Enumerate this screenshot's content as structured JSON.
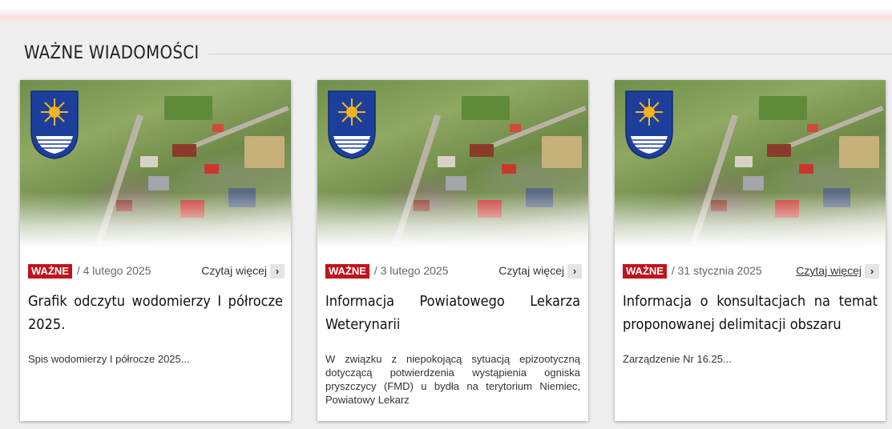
{
  "section": {
    "title": "WAŻNE WIADOMOŚCI"
  },
  "colors": {
    "badge": "#c0141b",
    "crest_blue": "#1d3f9c",
    "crest_gold": "#f2b321"
  },
  "cards": [
    {
      "badge": "WAŻNE",
      "date": "/ 4 lutego 2025",
      "read_more": "Czytaj więcej",
      "chevron": "›",
      "title": "Grafik odczytu wodomierzy I półrocze 2025.",
      "excerpt": "Spis wodomierzy I półrocze 2025..."
    },
    {
      "badge": "WAŻNE",
      "date": "/ 3 lutego 2025",
      "read_more": "Czytaj więcej",
      "chevron": "›",
      "title": "Informacja Powiatowego Lekarza Weterynarii",
      "excerpt": "W związku z niepokojącą sytuacją epizootyczną dotyczącą potwierdzenia wystąpienia ogniska pryszczycy (FMD) u bydła na terytorium Niemiec, Powiatowy Lekarz"
    },
    {
      "badge": "WAŻNE",
      "date": "/ 31 stycznia 2025",
      "read_more": "Czytaj więcej",
      "chevron": "›",
      "title": "Informacja o konsultacjach na temat proponowanej delimitacji obszaru",
      "excerpt": "Zarządzenie Nr 16.25..."
    }
  ]
}
